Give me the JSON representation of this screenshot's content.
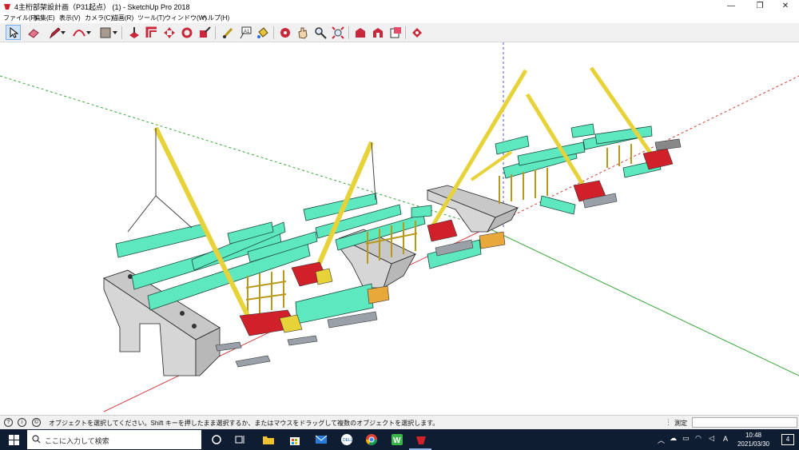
{
  "window": {
    "title": "4主桁部架設計画（P31起点） (1) - SketchUp Pro 2018",
    "minimize": "—",
    "maximize": "❐",
    "close": "✕"
  },
  "menu": [
    "ファイル(F)",
    "編集(E)",
    "表示(V)",
    "カメラ(C)",
    "描画(R)",
    "ツール(T)",
    "ウィンドウ(W)",
    "ヘルプ(H)"
  ],
  "toolbar": {
    "tools": [
      "select-tool",
      "eraser-tool",
      "line-tool",
      "arc-tool",
      "shape-tool",
      "push-pull-tool",
      "offset-tool",
      "move-tool",
      "rotate-tool",
      "scale-tool",
      "tape-measure-tool",
      "text-tool",
      "paint-bucket-tool",
      "orbit-tool",
      "pan-tool",
      "zoom-tool",
      "zoom-extents-tool",
      "warehouse-tool",
      "extension-warehouse-tool",
      "layout-tool",
      "extension-manager-tool"
    ],
    "active_tool": "select-tool"
  },
  "status": {
    "message": "オブジェクトを選択してください。Shift キーを押したまま選択するか、またはマウスをドラッグして複数のオブジェクトを選択します。",
    "measure_label": "測定",
    "measure_value": ""
  },
  "taskbar": {
    "search_placeholder": "ここに入力して検索",
    "pinned": [
      "task-view",
      "file-explorer",
      "store",
      "mail",
      "dell",
      "chrome",
      "wps-writer",
      "sketchup"
    ],
    "ime": "A",
    "time": "10:48",
    "date": "2021/03/30",
    "notifications": "4"
  },
  "colors": {
    "girder": "#5ee8c0",
    "crane": "#e8d23a",
    "crane_body": "#d0202a",
    "pier": "#d6d6d6",
    "taskbar": "#0f1d33",
    "axis_red": "#d04040",
    "axis_green": "#3aa83a",
    "axis_blue": "#5050d8"
  }
}
